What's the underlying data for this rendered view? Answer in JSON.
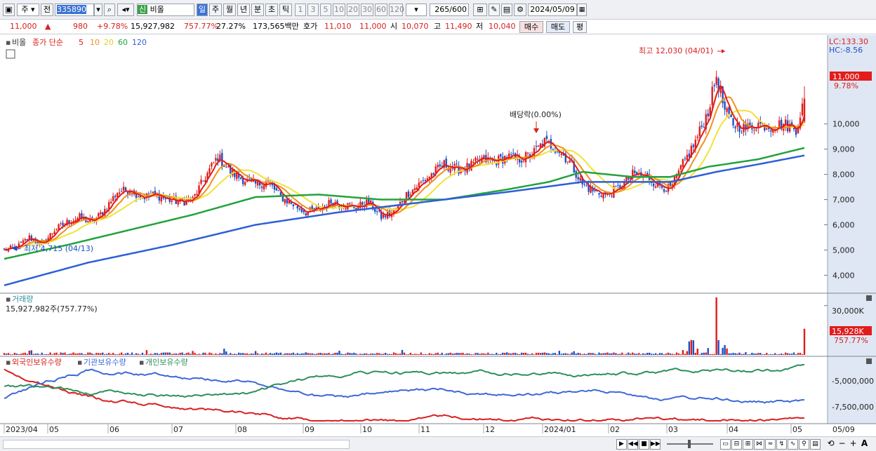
{
  "toolbar": {
    "market": "주",
    "prefix": "전",
    "code": "335890",
    "new_badge": "신",
    "name": "비올",
    "periods": [
      "일",
      "주",
      "월",
      "년",
      "분",
      "초",
      "틱"
    ],
    "minutes": [
      "1",
      "3",
      "5",
      "10",
      "20",
      "30",
      "60",
      "120"
    ],
    "count": "265",
    "count_total": "/600",
    "date": "2024/05/09"
  },
  "quote": {
    "price": "11,000",
    "change": "980",
    "change_pct": "+9.78%",
    "volume": "15,927,982",
    "volume_pct": "757.77%",
    "turnover": "27.27%",
    "amount": "173,565백만",
    "ask_label": "호가",
    "ask1": "11,010",
    "ask2": "11,000",
    "open_label": "시",
    "open": "10,070",
    "high_label": "고",
    "high": "11,490",
    "low_label": "저",
    "low": "10,040",
    "buy_label": "매수",
    "sell_label": "매도",
    "eval_label": "평"
  },
  "chart_data": [
    {
      "type": "candlestick",
      "legend": {
        "stock": "비올",
        "ma_label": "종가 단순",
        "ma_periods": [
          "5",
          "10",
          "20",
          "60",
          "120"
        ]
      },
      "ma_colors": {
        "5": "#e01a1a",
        "10": "#f0901e",
        "20": "#f1e23a",
        "60": "#22a33c",
        "120": "#2e5fd8"
      },
      "ylim": [
        3400,
        13300
      ],
      "y_ticks": [
        "4,000",
        "5,000",
        "6,000",
        "7,000",
        "8,000",
        "9,000",
        "10,000"
      ],
      "lc": "LC:133.30",
      "hc": "HC:-8.56",
      "last_price_tag": "11,000",
      "last_pct_tag": "9.78%",
      "annotations": {
        "high": "최고 12,030 (04/01)",
        "low": "최저 4,715 (04/13)",
        "dividend": "배당락(0.00%)"
      },
      "close_path": [
        [
          0,
          5000
        ],
        [
          6,
          5100
        ],
        [
          12,
          5500
        ],
        [
          18,
          5200
        ],
        [
          24,
          5800
        ],
        [
          30,
          6100
        ],
        [
          36,
          6300
        ],
        [
          42,
          6100
        ],
        [
          48,
          6600
        ],
        [
          54,
          7300
        ],
        [
          60,
          7400
        ],
        [
          66,
          7100
        ],
        [
          72,
          7200
        ],
        [
          78,
          7000
        ],
        [
          84,
          6900
        ],
        [
          90,
          7000
        ],
        [
          96,
          7900
        ],
        [
          102,
          8700
        ],
        [
          108,
          8100
        ],
        [
          114,
          7800
        ],
        [
          120,
          7600
        ],
        [
          126,
          7700
        ],
        [
          132,
          7100
        ],
        [
          138,
          6800
        ],
        [
          144,
          6500
        ],
        [
          150,
          6600
        ],
        [
          156,
          6900
        ],
        [
          162,
          6800
        ],
        [
          168,
          6700
        ],
        [
          174,
          6900
        ],
        [
          180,
          6300
        ],
        [
          186,
          6500
        ],
        [
          192,
          7200
        ],
        [
          198,
          7600
        ],
        [
          204,
          8000
        ],
        [
          210,
          8400
        ],
        [
          216,
          8200
        ],
        [
          222,
          8300
        ],
        [
          228,
          8600
        ],
        [
          234,
          8500
        ],
        [
          240,
          8700
        ],
        [
          246,
          8600
        ],
        [
          252,
          8800
        ],
        [
          258,
          9300
        ],
        [
          264,
          9000
        ],
        [
          270,
          8500
        ],
        [
          276,
          7600
        ],
        [
          282,
          7300
        ],
        [
          288,
          7200
        ],
        [
          294,
          7500
        ],
        [
          300,
          8000
        ],
        [
          306,
          7900
        ],
        [
          312,
          7600
        ],
        [
          318,
          7400
        ],
        [
          324,
          8400
        ],
        [
          330,
          9300
        ],
        [
          336,
          10500
        ],
        [
          340,
          11900
        ],
        [
          344,
          10500
        ],
        [
          348,
          10000
        ],
        [
          354,
          9800
        ],
        [
          360,
          10000
        ],
        [
          366,
          9900
        ],
        [
          372,
          10000
        ],
        [
          378,
          9800
        ],
        [
          382,
          11000
        ]
      ],
      "ma60_path": [
        [
          0,
          4650
        ],
        [
          30,
          5200
        ],
        [
          60,
          5800
        ],
        [
          90,
          6400
        ],
        [
          120,
          7100
        ],
        [
          150,
          7200
        ],
        [
          180,
          7000
        ],
        [
          210,
          7000
        ],
        [
          240,
          7400
        ],
        [
          260,
          7700
        ],
        [
          276,
          8100
        ],
        [
          300,
          7900
        ],
        [
          318,
          7900
        ],
        [
          336,
          8300
        ],
        [
          360,
          8600
        ],
        [
          382,
          9050
        ]
      ],
      "ma120_path": [
        [
          0,
          3600
        ],
        [
          40,
          4500
        ],
        [
          80,
          5200
        ],
        [
          120,
          6000
        ],
        [
          160,
          6500
        ],
        [
          200,
          6900
        ],
        [
          240,
          7300
        ],
        [
          276,
          7700
        ],
        [
          300,
          7700
        ],
        [
          318,
          7700
        ],
        [
          340,
          8100
        ],
        [
          360,
          8400
        ],
        [
          382,
          8750
        ]
      ],
      "x_ticks": [
        "2023/04",
        "05",
        "06",
        "07",
        "08",
        "09",
        "10",
        "11",
        "12",
        "2024/01",
        "02",
        "03",
        "04",
        "05"
      ],
      "x_last": "05/09"
    },
    {
      "type": "bar",
      "title": "거래량",
      "value_text": "15,927,982주(757.77%)",
      "ylim": [
        0,
        35000
      ],
      "y_ticks": [
        "30,000K"
      ],
      "last_tag": "15,928K",
      "last_pct_tag": "757.77%",
      "spikes": [
        [
          327,
          8200
        ],
        [
          328,
          9100
        ],
        [
          329,
          8900
        ],
        [
          331,
          3800
        ],
        [
          336,
          4200
        ],
        [
          340,
          35000
        ],
        [
          341,
          9000
        ],
        [
          343,
          4300
        ],
        [
          344,
          6000
        ],
        [
          345,
          3900
        ],
        [
          382,
          15928
        ]
      ]
    },
    {
      "type": "line",
      "series": [
        {
          "name": "외국인보유수량",
          "color": "#d8201f"
        },
        {
          "name": "기관보유수량",
          "color": "#3c68d8"
        },
        {
          "name": "개인보유수량",
          "color": "#2e8f5c"
        }
      ],
      "y_ticks": [
        "-5,000,000",
        "-7,500,000"
      ]
    }
  ]
}
